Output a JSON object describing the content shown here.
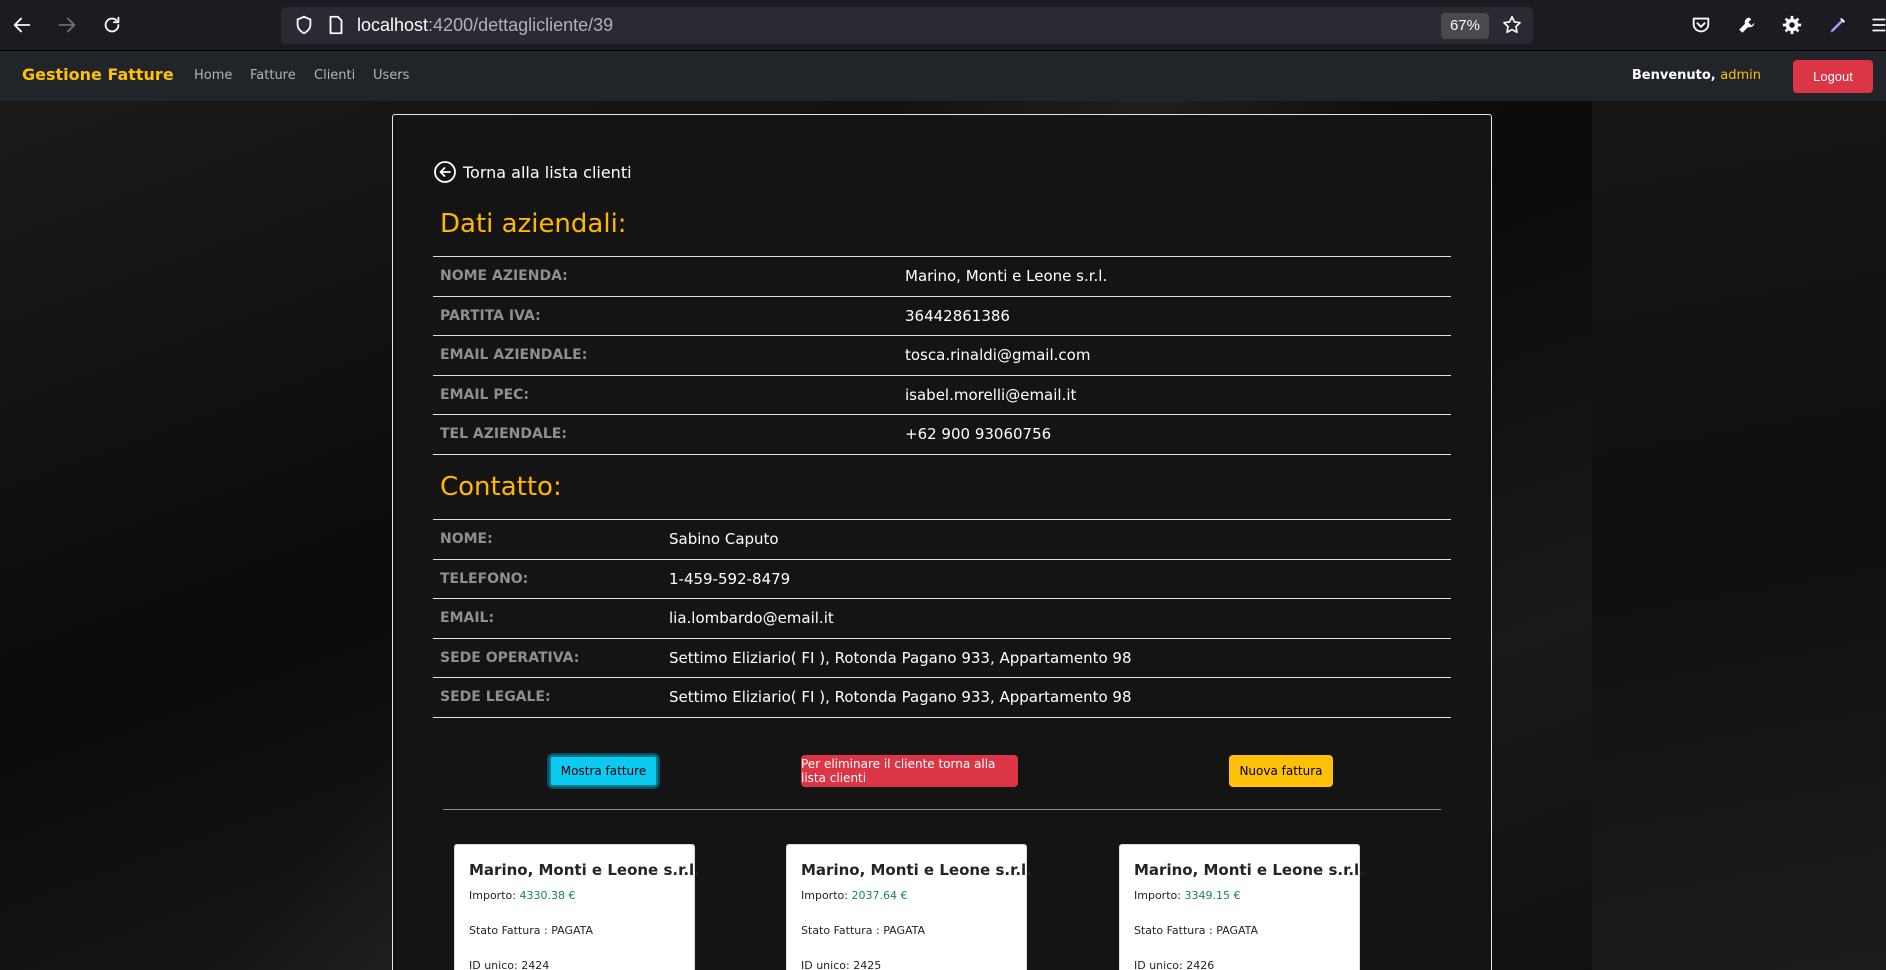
{
  "browser": {
    "url_host": "localhost",
    "url_path": ":4200/dettaglicliente/39",
    "zoom": "67%"
  },
  "navbar": {
    "brand": "Gestione Fatture",
    "links": [
      "Home",
      "Fatture",
      "Clienti",
      "Users"
    ],
    "welcome_prefix": "Benvenuto,",
    "username": "admin",
    "logout_label": "Logout"
  },
  "back_link": "Torna alla lista clienti",
  "azienda": {
    "title": "Dati aziendali:",
    "rows": [
      {
        "label": "NOME AZIENDA:",
        "value": "Marino, Monti e Leone s.r.l."
      },
      {
        "label": "PARTITA IVA:",
        "value": "36442861386"
      },
      {
        "label": "EMAIL AZIENDALE:",
        "value": "tosca.rinaldi@gmail.com"
      },
      {
        "label": "EMAIL PEC:",
        "value": "isabel.morelli@email.it"
      },
      {
        "label": "TEL AZIENDALE:",
        "value": "+62 900 93060756"
      }
    ]
  },
  "contatto": {
    "title": "Contatto:",
    "rows": [
      {
        "label": "NOME:",
        "value": "Sabino Caputo"
      },
      {
        "label": "TELEFONO:",
        "value": "1-459-592-8479"
      },
      {
        "label": "EMAIL:",
        "value": "lia.lombardo@email.it"
      },
      {
        "label": "SEDE OPERATIVA:",
        "value": "Settimo Eliziario( FI ), Rotonda Pagano 933, Appartamento 98"
      },
      {
        "label": "SEDE LEGALE:",
        "value": "Settimo Eliziario( FI ), Rotonda Pagano 933, Appartamento 98"
      }
    ]
  },
  "buttons": {
    "mostra_fatture": "Mostra fatture",
    "elimina": "Per eliminare il cliente torna alla lista clienti",
    "nuova_fattura": "Nuova fattura"
  },
  "fatture": [
    {
      "cliente": "Marino, Monti e Leone s.r.l.",
      "importo_label": "Importo:",
      "importo": "4330.38 €",
      "stato_label": "Stato Fattura :",
      "stato": "PAGATA",
      "id_label": "ID unico:",
      "id": "2424"
    },
    {
      "cliente": "Marino, Monti e Leone s.r.l.",
      "importo_label": "Importo:",
      "importo": "2037.64 €",
      "stato_label": "Stato Fattura :",
      "stato": "PAGATA",
      "id_label": "ID unico:",
      "id": "2425"
    },
    {
      "cliente": "Marino, Monti e Leone s.r.l.",
      "importo_label": "Importo:",
      "importo": "3349.15 €",
      "stato_label": "Stato Fattura :",
      "stato": "PAGATA",
      "id_label": "ID unico:",
      "id": "2426"
    }
  ],
  "icons": {
    "back": "arrow-left-icon",
    "forward": "arrow-right-icon",
    "reload": "reload-icon",
    "shield": "shield-icon",
    "page": "page-icon",
    "star": "star-icon",
    "pocket": "pocket-icon",
    "wrench": "wrench-icon",
    "gear": "gear-icon",
    "pen": "pen-icon",
    "menu": "menu-icon",
    "back_circle": "arrow-circle-left-icon"
  },
  "colors": {
    "brand": "#ffc107",
    "section_title": "#ffb703",
    "logout": "#dc3545",
    "info_button": "#0dcaf0",
    "amount": "#198754"
  }
}
